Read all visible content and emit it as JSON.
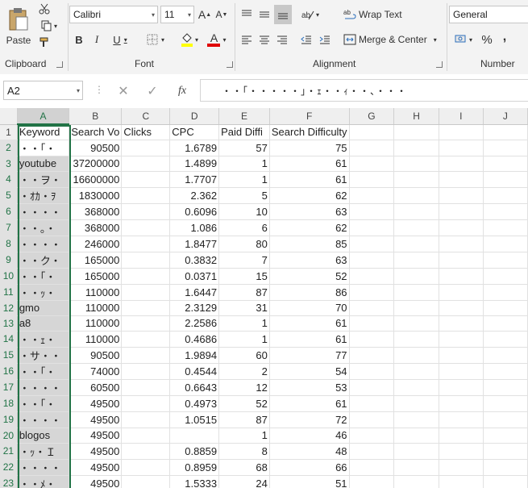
{
  "ribbon": {
    "clipboard": {
      "paste_label": "Paste",
      "group_label": "Clipboard"
    },
    "font": {
      "font_name": "Calibri",
      "font_size": "11",
      "grow_label": "A",
      "shrink_label": "A",
      "bold": "B",
      "italic": "I",
      "underline": "U",
      "fill_letter": "",
      "font_color_letter": "A",
      "group_label": "Font"
    },
    "alignment": {
      "wrap_text": "Wrap Text",
      "merge_center": "Merge & Center",
      "group_label": "Alignment"
    },
    "number": {
      "format": "General",
      "percent": "%",
      "comma": ",",
      "group_label": "Number"
    }
  },
  "formula_bar": {
    "name_box": "A2",
    "fx": "fx",
    "content": "・・「・・・・・」・ｪ・・ｨ・・、・・・"
  },
  "columns": [
    "A",
    "B",
    "C",
    "D",
    "E",
    "F",
    "G",
    "H",
    "I",
    "J"
  ],
  "rows": [
    {
      "n": "1",
      "cells": [
        "Keyword",
        "Search Vo",
        "Clicks",
        "CPC",
        "Paid Diffi",
        "Search Difficulty",
        "",
        "",
        "",
        ""
      ]
    },
    {
      "n": "2",
      "cells": [
        "・・「・",
        "90500",
        "",
        "1.6789",
        "57",
        "75",
        "",
        "",
        "",
        ""
      ]
    },
    {
      "n": "3",
      "cells": [
        "youtube",
        "37200000",
        "",
        "1.4899",
        "1",
        "61",
        "",
        "",
        "",
        ""
      ]
    },
    {
      "n": "4",
      "cells": [
        "・・ヲ・",
        "16600000",
        "",
        "1.7707",
        "1",
        "61",
        "",
        "",
        "",
        ""
      ]
    },
    {
      "n": "5",
      "cells": [
        "・ｵｶ・ｦ",
        "1830000",
        "",
        "2.362",
        "5",
        "62",
        "",
        "",
        "",
        ""
      ]
    },
    {
      "n": "6",
      "cells": [
        "・・・・",
        "368000",
        "",
        "0.6096",
        "10",
        "63",
        "",
        "",
        "",
        ""
      ]
    },
    {
      "n": "7",
      "cells": [
        "・・。・",
        "368000",
        "",
        "1.086",
        "6",
        "62",
        "",
        "",
        "",
        ""
      ]
    },
    {
      "n": "8",
      "cells": [
        "・・・・",
        "246000",
        "",
        "1.8477",
        "80",
        "85",
        "",
        "",
        "",
        ""
      ]
    },
    {
      "n": "9",
      "cells": [
        "・・ク・",
        "165000",
        "",
        "0.3832",
        "7",
        "63",
        "",
        "",
        "",
        ""
      ]
    },
    {
      "n": "10",
      "cells": [
        "・・「・",
        "165000",
        "",
        "0.0371",
        "15",
        "52",
        "",
        "",
        "",
        ""
      ]
    },
    {
      "n": "11",
      "cells": [
        "・・ｯ・",
        "110000",
        "",
        "1.6447",
        "87",
        "86",
        "",
        "",
        "",
        ""
      ]
    },
    {
      "n": "12",
      "cells": [
        "gmo",
        "110000",
        "",
        "2.3129",
        "31",
        "70",
        "",
        "",
        "",
        ""
      ]
    },
    {
      "n": "13",
      "cells": [
        "a8",
        "110000",
        "",
        "2.2586",
        "1",
        "61",
        "",
        "",
        "",
        ""
      ]
    },
    {
      "n": "14",
      "cells": [
        "・・ｪ・",
        "110000",
        "",
        "0.4686",
        "1",
        "61",
        "",
        "",
        "",
        ""
      ]
    },
    {
      "n": "15",
      "cells": [
        "・サ・・",
        "90500",
        "",
        "1.9894",
        "60",
        "77",
        "",
        "",
        "",
        ""
      ]
    },
    {
      "n": "16",
      "cells": [
        "・・「・",
        "74000",
        "",
        "0.4544",
        "2",
        "54",
        "",
        "",
        "",
        ""
      ]
    },
    {
      "n": "17",
      "cells": [
        "・・・・",
        "60500",
        "",
        "0.6643",
        "12",
        "53",
        "",
        "",
        "",
        ""
      ]
    },
    {
      "n": "18",
      "cells": [
        "・・「・",
        "49500",
        "",
        "0.4973",
        "52",
        "61",
        "",
        "",
        "",
        ""
      ]
    },
    {
      "n": "19",
      "cells": [
        "・・・・",
        "49500",
        "",
        "1.0515",
        "87",
        "72",
        "",
        "",
        "",
        ""
      ]
    },
    {
      "n": "20",
      "cells": [
        "blogos",
        "49500",
        "",
        "",
        "1",
        "46",
        "",
        "",
        "",
        ""
      ]
    },
    {
      "n": "21",
      "cells": [
        "・ｯ・Ｉ",
        "49500",
        "",
        "0.8859",
        "8",
        "48",
        "",
        "",
        "",
        ""
      ]
    },
    {
      "n": "22",
      "cells": [
        "・・・・",
        "49500",
        "",
        "0.8959",
        "68",
        "66",
        "",
        "",
        "",
        ""
      ]
    },
    {
      "n": "23",
      "cells": [
        "・・ﾒ・",
        "49500",
        "",
        "1.5333",
        "24",
        "51",
        "",
        "",
        "",
        ""
      ]
    }
  ]
}
